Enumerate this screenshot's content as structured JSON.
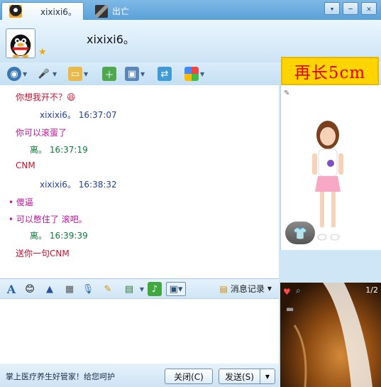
{
  "tabs": [
    {
      "label": "xixixi6。",
      "active": true
    },
    {
      "label": "出亡",
      "active": false
    }
  ],
  "header": {
    "contact_name": "xixixi6。"
  },
  "ad": {
    "text": "再长5cm"
  },
  "messages": [
    {
      "text": "你想我开不？😆",
      "color": "#c8102e"
    },
    {
      "text": "xixixi6。  16:37:07",
      "color": "#1f3f9f"
    },
    {
      "text": "你可以滚蛋了",
      "color": "#c0149a"
    },
    {
      "text": "离。  16:37:19",
      "color": "#0a7a3a"
    },
    {
      "text": "CNM",
      "color": "#c8102e"
    },
    {
      "text": "xixixi6。  16:38:32",
      "color": "#1f3f9f"
    },
    {
      "text": "• 傻逼",
      "color": "#c0149a"
    },
    {
      "text": "• 可以憋住了 滚吧。",
      "color": "#c0149a"
    },
    {
      "text": "离。  16:39:39",
      "color": "#0a7a3a"
    },
    {
      "text": "送你一句CNM",
      "color": "#c8102e"
    }
  ],
  "format_toolbar": {
    "history_label": "消息记录"
  },
  "bottom": {
    "promo": "掌上医疗养生好管家！给您呵护",
    "close_label": "关闭(C)",
    "send_label": "发送(S)"
  },
  "video": {
    "pager": "1/2"
  },
  "colors": {
    "accent": "#5aa1d8",
    "ad_bg": "#ffd400",
    "ad_text": "#e0001b"
  }
}
